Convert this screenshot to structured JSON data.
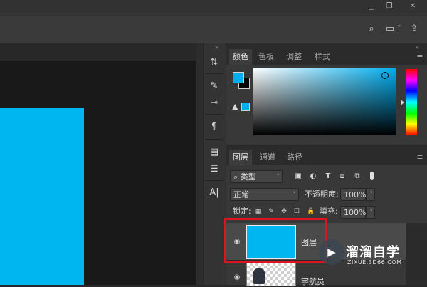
{
  "window": {
    "minimize_glyph": "▁",
    "restore_glyph": "❐",
    "close_glyph": "✕"
  },
  "options_bar": {
    "search_glyph": "⌕",
    "workspace_glyph": "▭",
    "workspace_chevron": "˅",
    "share_glyph": "⇪"
  },
  "tools": {
    "collapse_glyph": "»",
    "items": [
      "⇅",
      "✎",
      "⊸",
      "¶",
      "▤",
      "☰",
      "A|"
    ]
  },
  "color_panel": {
    "tabs": [
      "颜色",
      "色板",
      "调整",
      "样式"
    ],
    "active_tab": 0,
    "menu_glyph": "≡",
    "warning_glyph": "▲",
    "foreground": "#00aeef",
    "background": "#000000",
    "collapse_glyph": "«"
  },
  "layers_panel": {
    "tabs": [
      "图层",
      "通道",
      "路径"
    ],
    "active_tab": 0,
    "menu_glyph": "≡",
    "filter_kind": "类型",
    "filter_search_glyph": "⌕",
    "filter_icons": [
      "▣",
      "◐",
      "T",
      "⧈",
      "⧉"
    ],
    "blend_mode": "正常",
    "opacity_label": "不透明度:",
    "opacity_value": "100%",
    "lock_label": "锁定:",
    "lock_icons": [
      "▦",
      "✎",
      "✥",
      "⧠",
      "🔒"
    ],
    "fill_label": "填充:",
    "fill_value": "100%",
    "chevron": "˅",
    "eye_glyph": "◉",
    "layers": [
      {
        "name": "图层",
        "color": "#00b6f0",
        "selected": true
      },
      {
        "name": "宇航员",
        "selected": false
      }
    ]
  },
  "watermark": {
    "logo_glyph": "▶",
    "title": "溜溜自学",
    "subtitle": "ZIXUE.3D66.COM"
  }
}
